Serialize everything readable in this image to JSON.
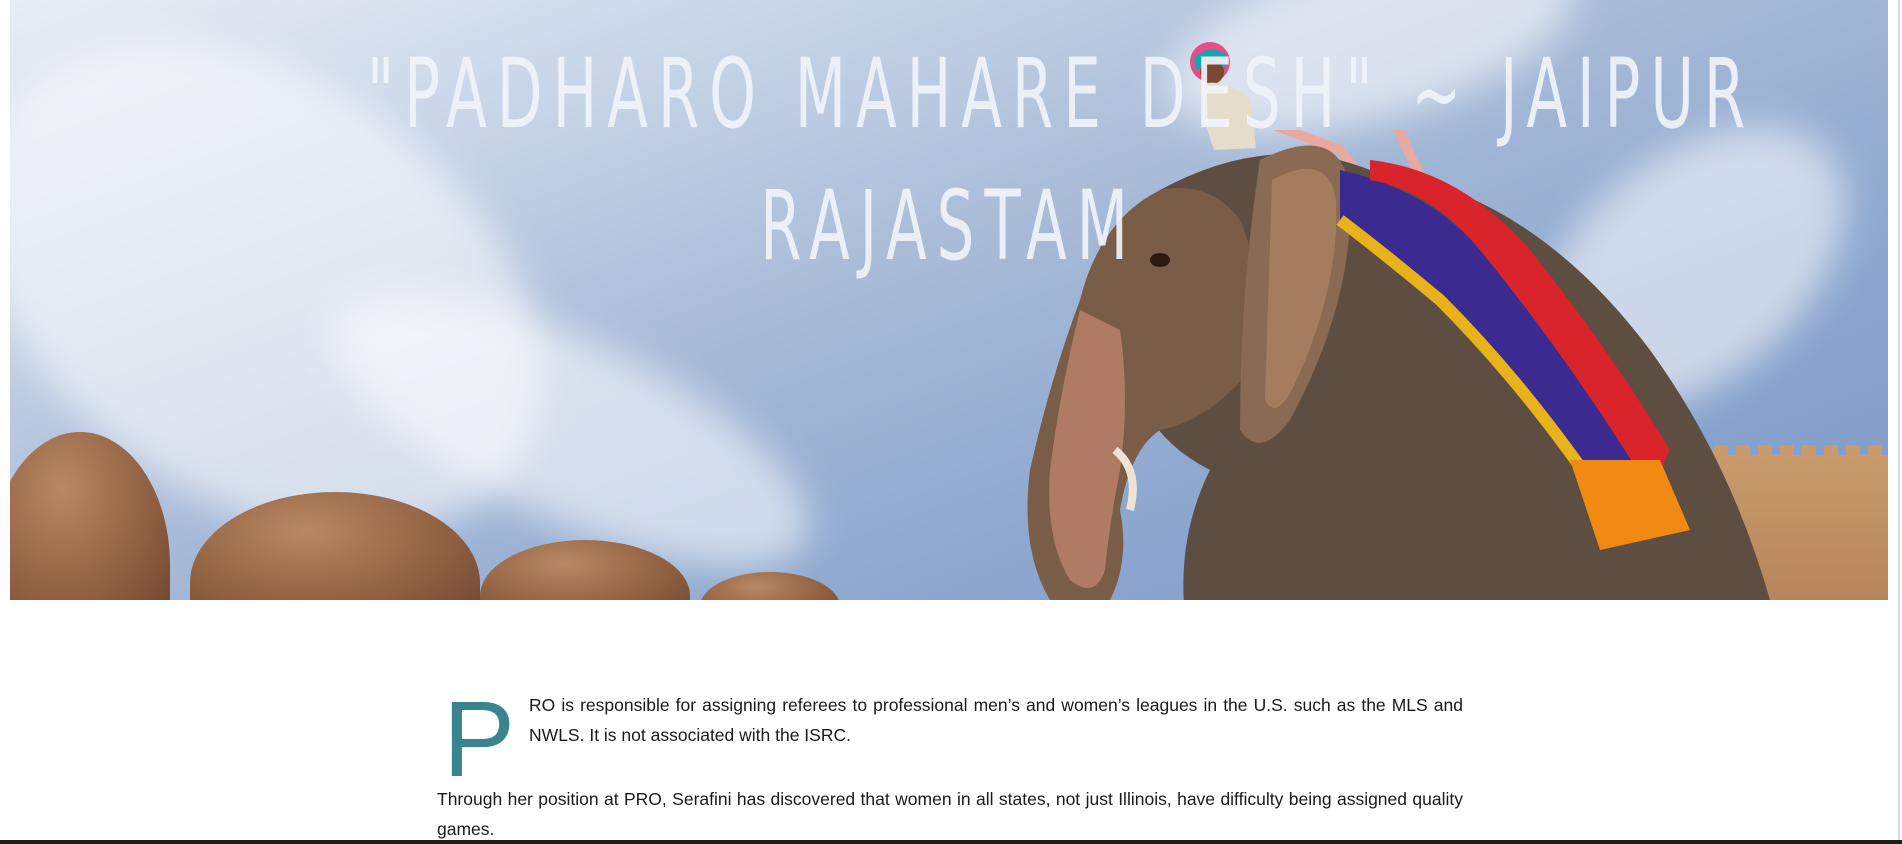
{
  "hero": {
    "title_line_1": "\"PADHARO MAHARE DESH\" ~ JAIPUR",
    "title_line_2": "RAJASTAM",
    "image_subject": "elephant-with-rider"
  },
  "article": {
    "dropcap": "P",
    "paragraph_1_rest": "RO is responsible for assigning referees to professional men’s and women’s leagues in the U.S. such as the MLS and NWLS. It is not associated with the ISRC.",
    "paragraph_2": "Through her position at PRO, Serafini has discovered that women in all states, not just Illinois, have difficulty being assigned quality games."
  },
  "colors": {
    "dropcap": "#3a8490",
    "body_text": "#1a1a1a",
    "title": "#f0f3fa"
  }
}
